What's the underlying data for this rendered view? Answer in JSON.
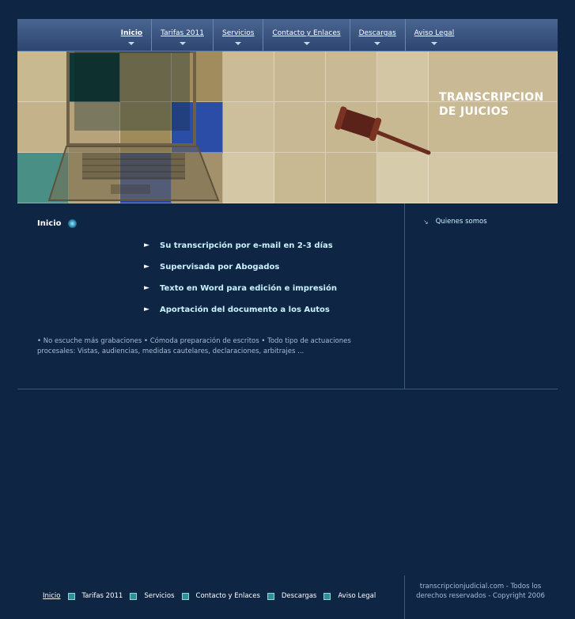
{
  "nav": {
    "items": [
      {
        "label": "Inicio"
      },
      {
        "label": "Tarifas 2011"
      },
      {
        "label": "Servicios"
      },
      {
        "label": "Contacto y Enlaces"
      },
      {
        "label": "Descargas"
      },
      {
        "label": "Aviso Legal"
      }
    ]
  },
  "banner": {
    "title_line1": "TRANSCRIPCION",
    "title_line2": "DE JUICIOS"
  },
  "main": {
    "title": "Inicio",
    "features": [
      "Su transcripción por e-mail en 2-3 días",
      "Supervisada por Abogados",
      "Texto en Word para edición e impresión",
      "Aportación del documento a los Autos"
    ],
    "bullet": "►",
    "description": "• No escuche más grabaciones • Cómoda preparación de escritos • Todo tipo de actuaciones procesales: Vistas, audiencias, medidas cautelares, declaraciones, arbitrajes ..."
  },
  "sidebar": {
    "link": "Quienes somos"
  },
  "footer": {
    "links": [
      "Inicio",
      "Tarifas 2011",
      "Servicios",
      "Contacto y Enlaces",
      "Descargas",
      "Aviso Legal"
    ],
    "copyright": "transcripcionjudicial.com - Todos los derechos reservados - Copyright 2006"
  },
  "colors": {
    "background": "#0f2544",
    "nav": "#3a5680",
    "feature_text": "#c9f3ff"
  }
}
